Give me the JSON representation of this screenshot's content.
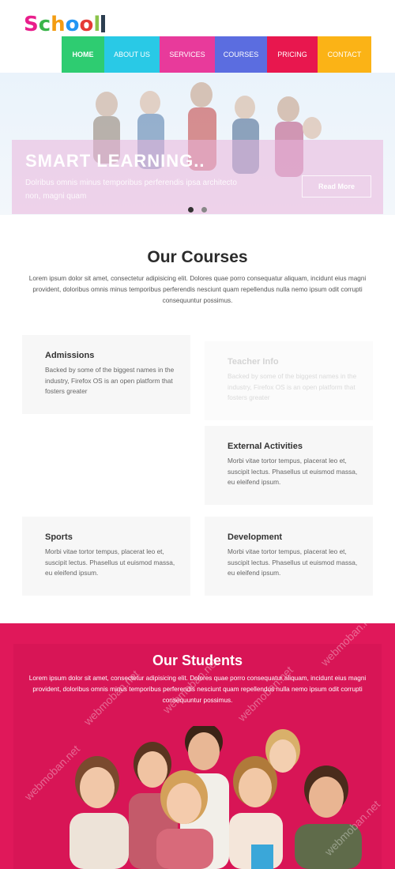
{
  "header": {
    "logo": {
      "letters": [
        {
          "char": "S",
          "color": "#e91e8c"
        },
        {
          "char": "c",
          "color": "#3ab54a"
        },
        {
          "char": "h",
          "color": "#f39c12"
        },
        {
          "char": "o",
          "color": "#2196f3"
        },
        {
          "char": "o",
          "color": "#e53935"
        },
        {
          "char": "l",
          "color": "#8bc34a"
        }
      ]
    },
    "nav": [
      {
        "label": "HOME",
        "color": "#2ecc71"
      },
      {
        "label": "ABOUT US",
        "color": "#29c9e6"
      },
      {
        "label": "SERVICES",
        "color": "#e83a9b"
      },
      {
        "label": "COURSES",
        "color": "#5b6de0"
      },
      {
        "label": "PRICING",
        "color": "#e8174e"
      },
      {
        "label": "CONTACT",
        "color": "#fbb316"
      }
    ]
  },
  "hero": {
    "title": "SMART LEARNING..",
    "text": "Dolribus omnis minus temporibus perferendis ipsa architecto non, magni quam",
    "button": "Read More",
    "slides": 2,
    "active_slide": 1
  },
  "courses": {
    "title": "Our Courses",
    "description": "Lorem ipsum dolor sit amet, consectetur adipisicing elit. Dolores quae porro consequatur aliquam, incidunt eius magni provident, doloribus omnis minus temporibus perferendis nesciunt quam repellendus nulla nemo ipsum odit corrupti consequuntur possimus.",
    "items": [
      {
        "title": "Admissions",
        "text": "Backed by some of the biggest names in the industry, Firefox OS is an open platform that fosters greater"
      },
      {
        "title": "Teacher Info",
        "text": "Backed by some of the biggest names in the industry, Firefox OS is an open platform that fosters greater"
      },
      {
        "title": "External Activities",
        "text": "Morbi vitae tortor tempus, placerat leo et, suscipit lectus. Phasellus ut euismod massa, eu eleifend ipsum."
      },
      {
        "title": "Sports",
        "text": "Morbi vitae tortor tempus, placerat leo et, suscipit lectus. Phasellus ut euismod massa, eu eleifend ipsum."
      },
      {
        "title": "Development",
        "text": "Morbi vitae tortor tempus, placerat leo et, suscipit lectus. Phasellus ut euismod massa, eu eleifend ipsum."
      }
    ]
  },
  "students": {
    "title": "Our Students",
    "description": "Lorem ipsum dolor sit amet, consectetur adipisicing elit. Dolores quae porro consequatur aliquam, incidunt eius magni provident, doloribus omnis minus temporibus perferendis nesciunt quam repellendus nulla nemo ipsum odit corrupti consequuntur possimus.",
    "accent_color": "#e0185a"
  },
  "watermark": "webmoban.net"
}
